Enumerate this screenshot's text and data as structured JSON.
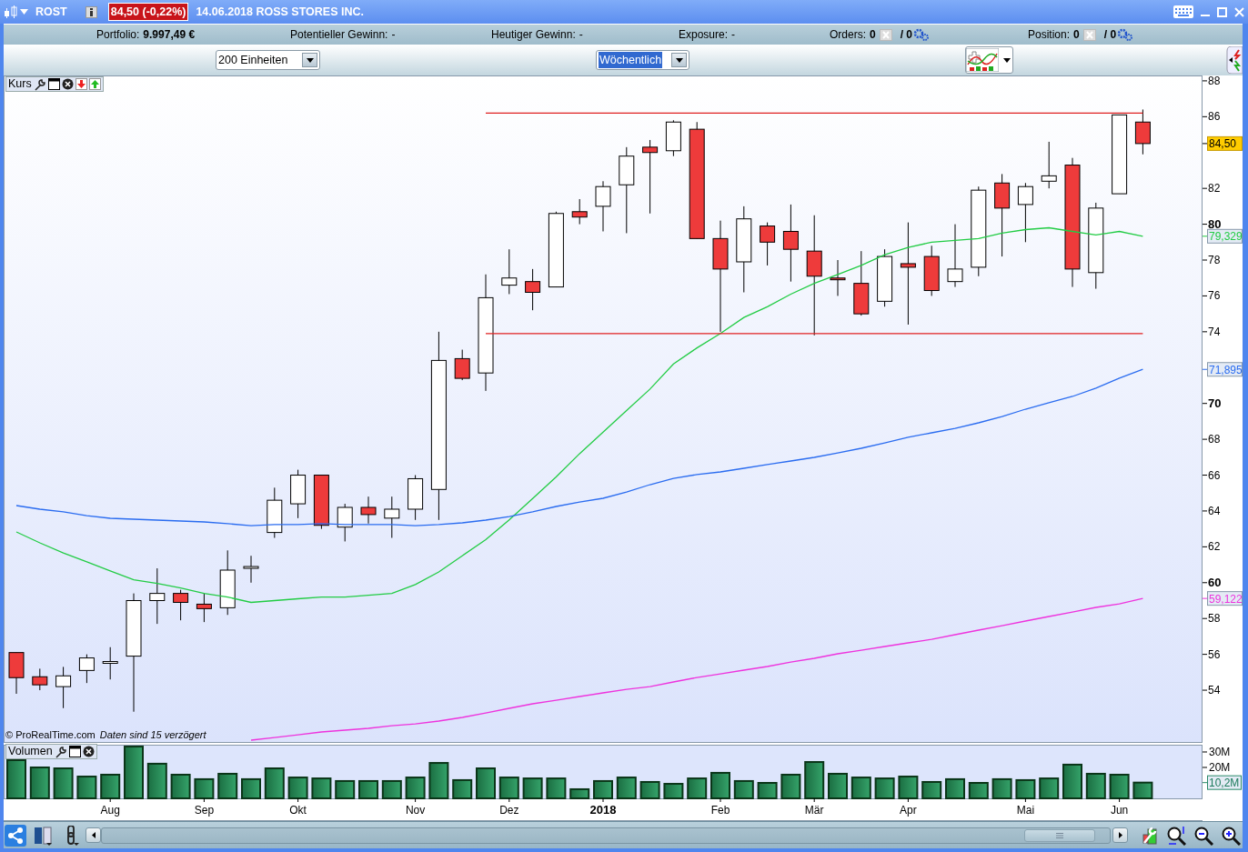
{
  "window": {
    "symbol": "ROST",
    "price_badge": "84,50 (-0,22%)",
    "title": "14.06.2018 ROSS STORES INC."
  },
  "stats": [
    {
      "label": "Portfolio:",
      "value": "9.997,49 €",
      "bold": true
    },
    {
      "label": "Potentieller Gewinn:",
      "value": "-",
      "bold": false
    },
    {
      "label": "Heutiger Gewinn:",
      "value": "-",
      "bold": false
    },
    {
      "label": "Exposure:",
      "value": "-",
      "bold": false
    }
  ],
  "counters": [
    {
      "label": "Orders:",
      "count": "0",
      "total": "/ 0"
    },
    {
      "label": "Position:",
      "count": "0",
      "total": "/ 0"
    }
  ],
  "toolbar": {
    "quantity": "200 Einheiten",
    "period": "Wöchentlich",
    "period_focused": true
  },
  "price_panel": {
    "title": "Kurs",
    "credit": "© ProRealTime.com",
    "delay_note": "Daten sind 15 verzögert",
    "chart_data": {
      "type": "candlestick",
      "ylim": [
        51.06,
        88.3
      ],
      "categories": [
        null,
        null,
        null,
        null,
        null,
        null,
        null,
        null,
        null,
        null,
        null,
        null,
        null,
        null,
        null,
        null,
        null,
        null,
        null,
        null,
        null,
        null,
        null,
        null,
        null,
        null,
        null,
        null,
        null,
        null,
        null,
        null,
        null,
        null,
        null,
        null,
        null,
        null,
        null,
        null,
        null,
        null,
        null,
        null,
        null,
        null,
        null,
        null,
        null
      ],
      "ohlc": [
        [
          56.1,
          56.1,
          53.8,
          54.7
        ],
        [
          54.75,
          55.2,
          54.0,
          54.3
        ],
        [
          54.2,
          55.3,
          53.0,
          54.8
        ],
        [
          55.1,
          56.0,
          54.4,
          55.8
        ],
        [
          55.5,
          56.4,
          54.6,
          55.6
        ],
        [
          55.9,
          59.4,
          52.8,
          59.0
        ],
        [
          59.0,
          60.8,
          57.7,
          59.4
        ],
        [
          59.4,
          59.6,
          57.9,
          58.9
        ],
        [
          58.8,
          59.4,
          57.8,
          58.55
        ],
        [
          58.6,
          61.8,
          58.2,
          60.7
        ],
        [
          60.8,
          61.5,
          60.0,
          60.9
        ],
        [
          62.8,
          65.3,
          62.5,
          64.6
        ],
        [
          64.4,
          66.3,
          63.6,
          66.0
        ],
        [
          66.0,
          66.0,
          63.0,
          63.2
        ],
        [
          63.1,
          64.4,
          62.3,
          64.2
        ],
        [
          64.2,
          64.8,
          63.3,
          63.8
        ],
        [
          63.6,
          64.8,
          62.5,
          64.1
        ],
        [
          64.1,
          66.0,
          63.5,
          65.8
        ],
        [
          65.2,
          74.0,
          63.5,
          72.4
        ],
        [
          72.5,
          73.0,
          71.3,
          71.4
        ],
        [
          71.7,
          77.2,
          70.7,
          75.9
        ],
        [
          76.6,
          78.6,
          76.1,
          77.0
        ],
        [
          76.8,
          77.5,
          75.2,
          76.2
        ],
        [
          76.5,
          80.7,
          76.5,
          80.6
        ],
        [
          80.7,
          81.4,
          80.0,
          80.4
        ],
        [
          81.0,
          82.4,
          79.6,
          82.1
        ],
        [
          82.2,
          84.3,
          79.5,
          83.8
        ],
        [
          84.3,
          84.7,
          80.6,
          84.0
        ],
        [
          84.1,
          85.8,
          83.8,
          85.7
        ],
        [
          85.3,
          85.7,
          79.2,
          79.2
        ],
        [
          79.2,
          80.2,
          74.0,
          77.5
        ],
        [
          77.9,
          81.0,
          76.2,
          80.3
        ],
        [
          79.9,
          80.1,
          77.7,
          79.0
        ],
        [
          79.6,
          81.1,
          76.8,
          78.6
        ],
        [
          78.5,
          80.5,
          73.8,
          77.1
        ],
        [
          77.0,
          78.0,
          76.0,
          76.9
        ],
        [
          76.7,
          78.5,
          74.9,
          75.0
        ],
        [
          75.7,
          78.6,
          75.4,
          78.2
        ],
        [
          77.8,
          80.1,
          74.4,
          77.6
        ],
        [
          78.2,
          78.8,
          76.0,
          76.3
        ],
        [
          76.8,
          80.0,
          76.5,
          77.5
        ],
        [
          77.6,
          82.1,
          77.1,
          81.9
        ],
        [
          82.3,
          82.8,
          78.2,
          80.9
        ],
        [
          81.1,
          82.3,
          79.0,
          82.1
        ],
        [
          82.4,
          84.6,
          82.0,
          82.7
        ],
        [
          83.3,
          83.7,
          76.5,
          77.5
        ],
        [
          77.3,
          81.2,
          76.4,
          80.9
        ],
        [
          81.7,
          86.1,
          81.7,
          86.1
        ],
        [
          85.7,
          86.4,
          83.9,
          84.5
        ]
      ],
      "series": [
        {
          "type": "line",
          "color": "#22cc44",
          "values": [
            62.83,
            62.22,
            61.66,
            61.16,
            60.66,
            60.16,
            59.96,
            59.7,
            59.4,
            59.2,
            58.9,
            59.0,
            59.1,
            59.2,
            59.2,
            59.3,
            59.4,
            59.9,
            60.6,
            61.5,
            62.4,
            63.5,
            64.7,
            65.9,
            67.2,
            68.4,
            69.6,
            70.8,
            72.2,
            73.1,
            73.9,
            74.8,
            75.4,
            76.1,
            76.7,
            77.2,
            77.7,
            78.3,
            78.7,
            79.0,
            79.1,
            79.2,
            79.5,
            79.7,
            79.8,
            79.6,
            79.4,
            79.6,
            79.33
          ]
        },
        {
          "type": "line",
          "color": "#2a6cf0",
          "values": [
            64.3,
            64.1,
            63.95,
            63.74,
            63.59,
            63.54,
            63.49,
            63.44,
            63.39,
            63.29,
            63.18,
            63.24,
            63.24,
            63.29,
            63.24,
            63.24,
            63.24,
            63.18,
            63.24,
            63.34,
            63.49,
            63.69,
            63.95,
            64.25,
            64.5,
            64.71,
            65.06,
            65.47,
            65.82,
            66.03,
            66.18,
            66.38,
            66.59,
            66.79,
            66.99,
            67.24,
            67.5,
            67.8,
            68.11,
            68.36,
            68.61,
            68.92,
            69.27,
            69.68,
            70.04,
            70.39,
            70.85,
            71.41,
            71.9
          ]
        },
        {
          "type": "line",
          "color": "#ee33dd",
          "values": [
            null,
            null,
            null,
            null,
            null,
            null,
            null,
            null,
            null,
            null,
            51.21,
            51.36,
            51.51,
            51.67,
            51.77,
            51.87,
            52.02,
            52.12,
            52.28,
            52.48,
            52.73,
            52.99,
            53.24,
            53.44,
            53.65,
            53.85,
            54.05,
            54.2,
            54.46,
            54.71,
            54.91,
            55.12,
            55.32,
            55.57,
            55.78,
            56.03,
            56.23,
            56.44,
            56.64,
            56.84,
            57.1,
            57.35,
            57.6,
            57.86,
            58.11,
            58.36,
            58.62,
            58.82,
            59.12
          ]
        },
        {
          "type": "line",
          "color": "#e02020",
          "values": [
            null,
            null,
            null,
            null,
            null,
            null,
            null,
            null,
            null,
            null,
            null,
            null,
            null,
            null,
            null,
            null,
            null,
            null,
            null,
            null,
            86.2,
            86.2,
            86.2,
            86.2,
            86.2,
            86.2,
            86.2,
            86.2,
            86.2,
            86.2,
            86.2,
            86.2,
            86.2,
            86.2,
            86.2,
            86.2,
            86.2,
            86.2,
            86.2,
            86.2,
            86.2,
            86.2,
            86.2,
            86.2,
            86.2,
            86.2,
            86.2,
            86.2,
            86.2
          ]
        },
        {
          "type": "line",
          "color": "#e02020",
          "values": [
            null,
            null,
            null,
            null,
            null,
            null,
            null,
            null,
            null,
            null,
            null,
            null,
            null,
            null,
            null,
            null,
            null,
            null,
            null,
            null,
            73.9,
            73.9,
            73.9,
            73.9,
            73.9,
            73.9,
            73.9,
            73.9,
            73.9,
            73.9,
            73.9,
            73.9,
            73.9,
            73.9,
            73.9,
            73.9,
            73.9,
            73.9,
            73.9,
            73.9,
            73.9,
            73.9,
            73.9,
            73.9,
            73.9,
            73.9,
            73.9,
            73.9,
            73.9
          ]
        }
      ],
      "yticks": [
        88,
        86,
        82,
        80,
        78,
        76,
        74,
        70,
        68,
        66,
        64,
        62,
        60,
        58,
        56,
        54
      ]
    },
    "axis_labels": [
      {
        "label": "84,50",
        "kind": "close"
      },
      {
        "label": "79,329",
        "kind": "average"
      },
      {
        "label": "71,895",
        "kind": "average"
      },
      {
        "label": "59,122",
        "kind": "average"
      }
    ]
  },
  "volume_panel": {
    "title": "Volumen",
    "last_label": "10,2M",
    "chart_data": {
      "type": "bar",
      "ylim": [
        0,
        34.7
      ],
      "categories": [
        null,
        null,
        null,
        null,
        "Aug",
        null,
        null,
        null,
        "Sep",
        null,
        null,
        null,
        "Okt",
        null,
        null,
        null,
        null,
        "Nov",
        null,
        null,
        null,
        "Dez",
        null,
        null,
        null,
        "2018",
        null,
        null,
        null,
        null,
        "Feb",
        null,
        null,
        null,
        "Mär",
        null,
        null,
        null,
        "Apr",
        null,
        null,
        null,
        null,
        "Mai",
        null,
        null,
        null,
        "Jun",
        null
      ],
      "values": [
        24.7,
        20,
        19.4,
        14.1,
        15.3,
        33.5,
        22.4,
        15.3,
        12.4,
        15.9,
        12.4,
        19.4,
        13.5,
        12.9,
        11.2,
        11.2,
        11.2,
        13.5,
        22.9,
        11.8,
        19.4,
        13.5,
        12.9,
        12.9,
        5.9,
        11.2,
        13.5,
        10.6,
        9.4,
        12.9,
        16.5,
        11.2,
        10,
        15.3,
        23.5,
        15.9,
        13.5,
        12.9,
        14.1,
        10.6,
        12.4,
        10,
        12.4,
        11.8,
        12.9,
        21.8,
        15.9,
        15.3,
        10.2
      ],
      "yticks": [
        {
          "value": 30,
          "label": "30M"
        },
        {
          "value": 20,
          "label": "20M"
        }
      ]
    }
  }
}
